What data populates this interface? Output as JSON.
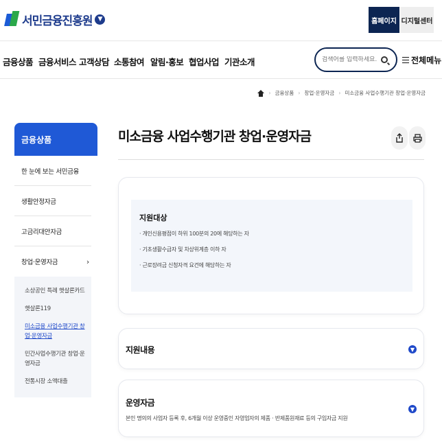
{
  "header": {
    "logo_text": "서민금융진흥원",
    "home_button": "홈페이지",
    "digital_button": "디지털센터"
  },
  "nav": {
    "items": [
      "금융상품",
      "금융서비스",
      "고객상담",
      "소통참여",
      "알림·홍보",
      "협업사업",
      "기관소개"
    ],
    "search_placeholder": "검색어를 입력하세요.",
    "all_menu": "전체메뉴"
  },
  "breadcrumb": {
    "items": [
      "금융상품",
      "창업·운영자금",
      "미소금융 사업수행기관 창업·운영자금"
    ]
  },
  "sidebar": {
    "heading": "금융상품",
    "items": [
      {
        "label": "한 눈에 보는 서민금융"
      },
      {
        "label": "생활안정자금"
      },
      {
        "label": "고금리대안자금"
      },
      {
        "label": "창업·운영자금"
      }
    ],
    "sub_items": [
      {
        "label": "소상공인 특례 햇살론카드"
      },
      {
        "label": "햇살론119"
      },
      {
        "label": "미소금융 사업수행기관 창업·운영자금"
      },
      {
        "label": "민간사업수행기관 창업·운영자금"
      },
      {
        "label": "전통시장 소액대출"
      }
    ]
  },
  "main": {
    "title": "미소금융 사업수행기관 창업·운영자금",
    "target": {
      "title": "지원대상",
      "items": [
        "개인신용평점이 하위 100분의 20에 해당하는 자",
        "기초생활수급자 및 차상위계층 이하 자",
        "근로장려금 신청자격 요건에 해당하는 자"
      ]
    },
    "section_content": "지원내용",
    "section_operating": "운영자금",
    "operating_desc": "본인 명의의 사업자 등록 후, 6개월 이상 운영중인 자영업자의 제품ㆍ반제품원재료 등의 구입자금 지원"
  },
  "colors": {
    "navy": "#0c2552",
    "accent_blue": "#1f59d6",
    "link_blue": "#1f49c9"
  }
}
